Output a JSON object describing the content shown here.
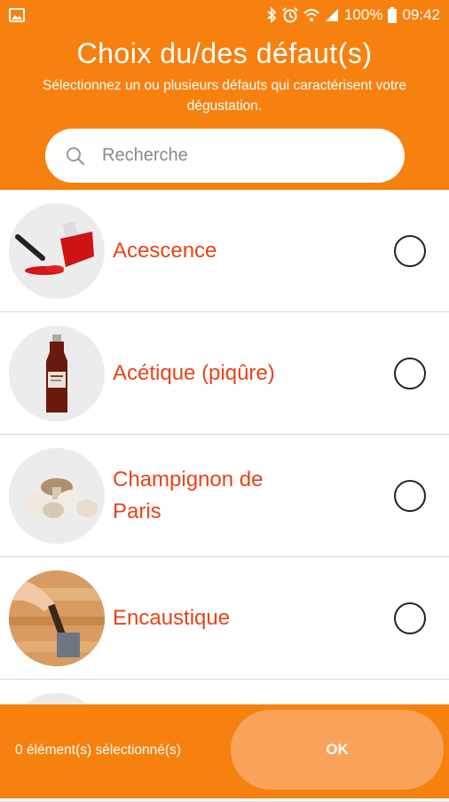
{
  "status": {
    "battery": "100%",
    "time": "09:42"
  },
  "header": {
    "title": "Choix du/des défaut(s)",
    "subtitle": "Sélectionnez un ou plusieurs défauts qui caractérisent votre dégustation."
  },
  "search": {
    "placeholder": "Recherche",
    "value": ""
  },
  "items": [
    {
      "label": "Acescence",
      "image": "red-nail-polish-spill",
      "selected": false
    },
    {
      "label": "Acétique (piqûre)",
      "image": "vinegar-bottle",
      "selected": false
    },
    {
      "label": "Champignon de Paris",
      "image": "button-mushrooms",
      "selected": false
    },
    {
      "label": "Encaustique",
      "image": "wood-varnish-brush",
      "selected": false
    }
  ],
  "footer": {
    "count_text": "0 élément(s) sélectionné(s)",
    "ok_label": "OK"
  },
  "colors": {
    "accent": "#f7810f",
    "label": "#e8431a",
    "ok_button": "#f9a35a"
  }
}
